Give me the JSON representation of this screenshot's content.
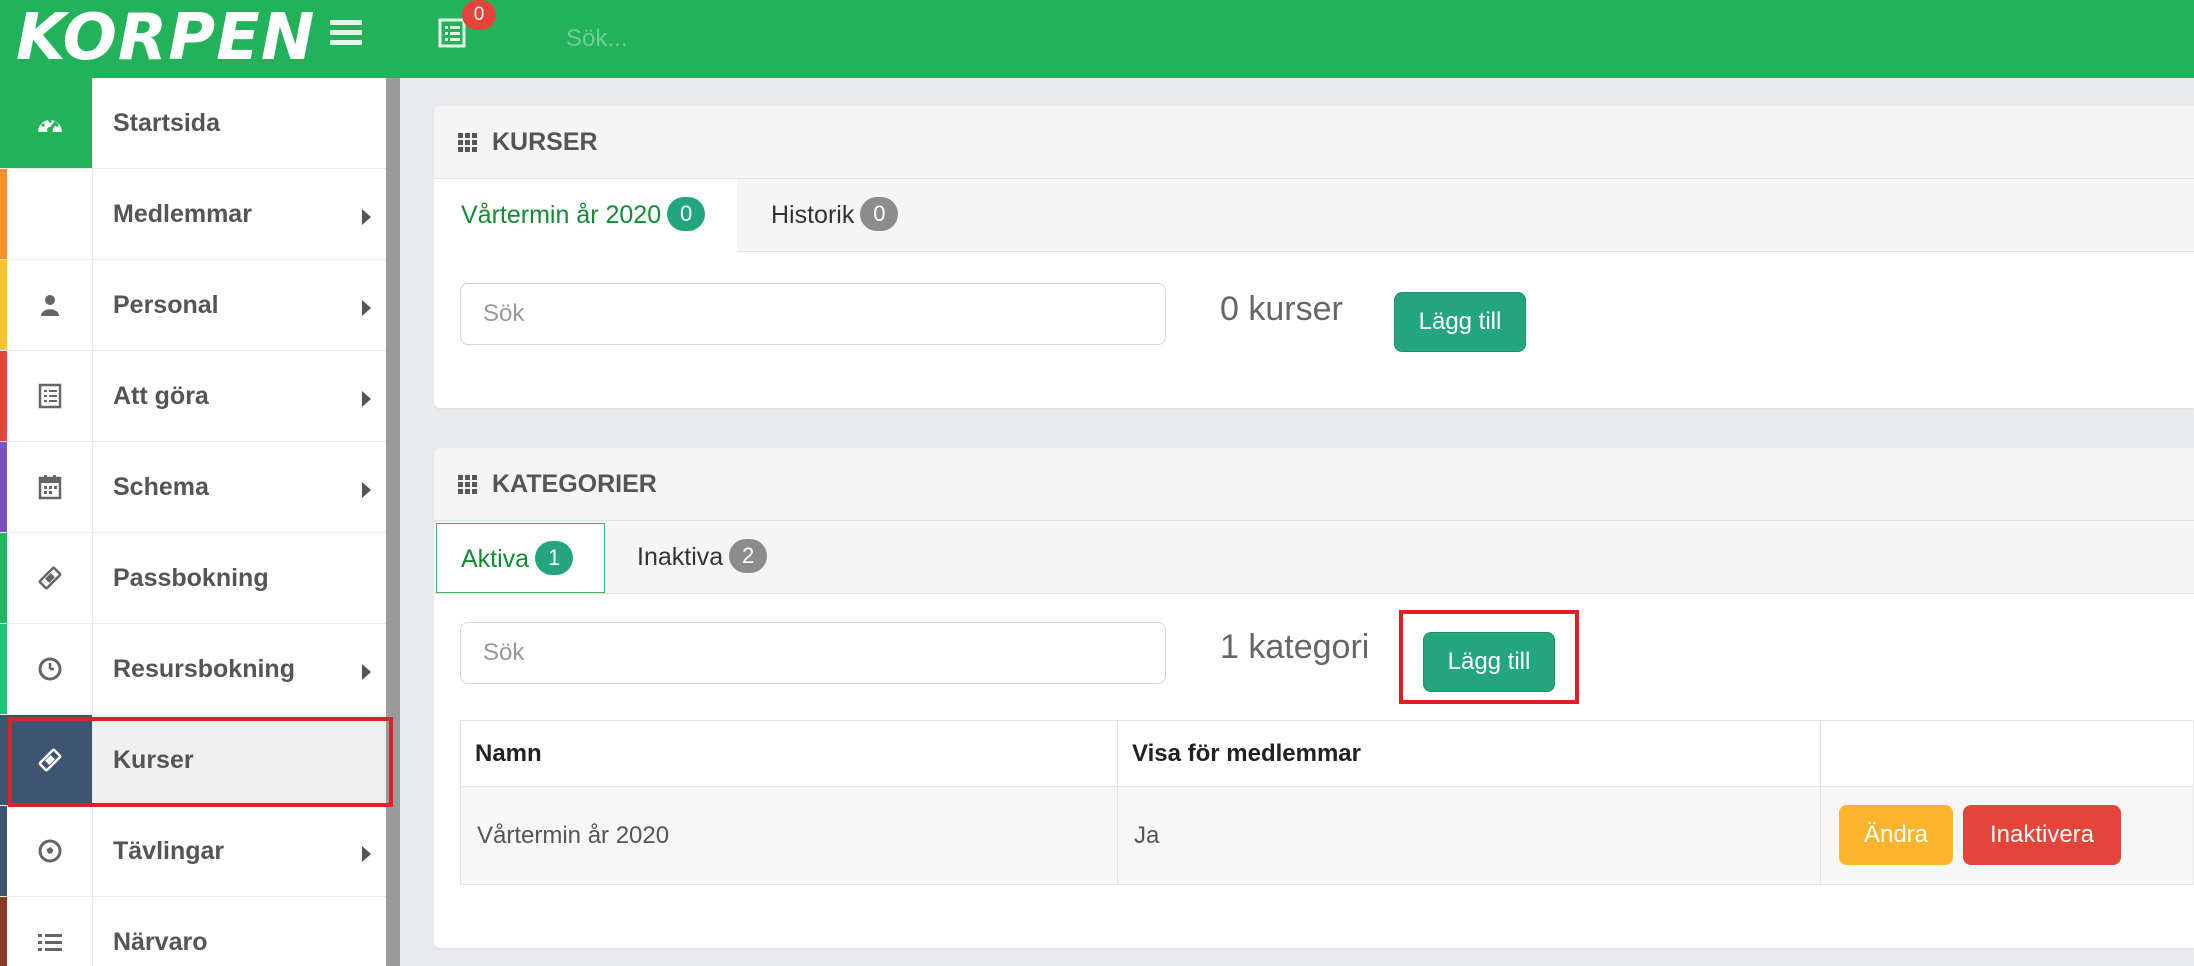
{
  "app": {
    "logo": "KORPEN",
    "notification_count": "0",
    "search_placeholder": "Sök..."
  },
  "sidebar": {
    "items": [
      {
        "label": "Startsida",
        "icon": "dashboard-icon",
        "accent": "#22b25a",
        "has_submenu": false
      },
      {
        "label": "Medlemmar",
        "icon": "users-icon",
        "accent": "#f7922e",
        "has_submenu": true
      },
      {
        "label": "Personal",
        "icon": "user-icon",
        "accent": "#f5c431",
        "has_submenu": true
      },
      {
        "label": "Att göra",
        "icon": "checklist-icon",
        "accent": "#e5443b",
        "has_submenu": true
      },
      {
        "label": "Schema",
        "icon": "calendar-icon",
        "accent": "#7b52c4",
        "has_submenu": true
      },
      {
        "label": "Passbokning",
        "icon": "ticket-icon",
        "accent": "#28b463",
        "has_submenu": false
      },
      {
        "label": "Resursbokning",
        "icon": "clock-icon",
        "accent": "#23c07a",
        "has_submenu": true
      },
      {
        "label": "Kurser",
        "icon": "ticket-icon",
        "accent": "#3d5570",
        "has_submenu": false
      },
      {
        "label": "Tävlingar",
        "icon": "soccer-ball-icon",
        "accent": "#3d5570",
        "has_submenu": true
      },
      {
        "label": "Närvaro",
        "icon": "list-icon",
        "accent": "#8b3a2a",
        "has_submenu": false
      }
    ]
  },
  "courses": {
    "title": "KURSER",
    "tabs": [
      {
        "label": "Vårtermin år 2020",
        "count": "0"
      },
      {
        "label": "Historik",
        "count": "0"
      }
    ],
    "search_placeholder": "Sök",
    "count_text": "0 kurser",
    "add_label": "Lägg till"
  },
  "categories": {
    "title": "KATEGORIER",
    "tabs": [
      {
        "label": "Aktiva",
        "count": "1"
      },
      {
        "label": "Inaktiva",
        "count": "2"
      }
    ],
    "search_placeholder": "Sök",
    "count_text": "1 kategori",
    "add_label": "Lägg till",
    "table": {
      "headers": [
        "Namn",
        "Visa för medlemmar",
        ""
      ],
      "rows": [
        {
          "name": "Vårtermin år 2020",
          "visible": "Ja",
          "edit_label": "Ändra",
          "deactivate_label": "Inaktivera"
        }
      ]
    }
  },
  "colors": {
    "brand_green": "#22b25a",
    "teal": "#23a67e",
    "highlight": "#e02027",
    "edit_button": "#fbb42b",
    "deactivate_button": "#e5443b"
  }
}
